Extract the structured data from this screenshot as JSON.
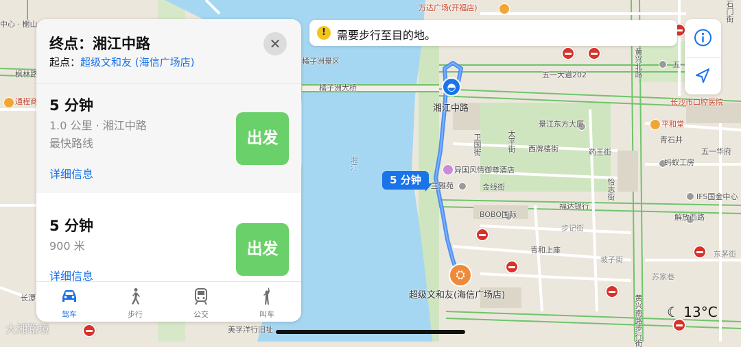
{
  "map": {
    "labels": {
      "wanda": "万达广场(开福店)",
      "xiangjiang_road": "湘江中路",
      "orange_isle": "橘子洲景区",
      "orange_bridge": "橘子洲大桥",
      "wuyi_ave": "五一大道202",
      "huangxing_n": "黄兴北路",
      "stomatology": "长沙市口腔医院",
      "hezhitang": "平和堂",
      "qingshijing": "青石井",
      "wuyi_hualou": "五一华府",
      "jingjiang": "景江东方大厦",
      "weiguo": "卫国街",
      "taiping": "太平街",
      "xipailou": "西牌楼街",
      "yaowang": "药王街",
      "yiguo": "异国风情御尊酒店",
      "lanyayuan": "兰雅苑",
      "jinxian": "金线街",
      "yizhi": "怡志街",
      "antworks": "蚂蚁工房",
      "ifs": "IFS国金中心",
      "fuda": "福达银行",
      "bobo": "BOBO国际",
      "jiefang_w": "解放西路",
      "buji": "步记街",
      "qinghe": "青和上座",
      "pozi": "坡子街",
      "dongmao": "东茅街",
      "sujia": "苏家巷",
      "destination_poi": "超级文和友(海信广场店)",
      "meiyang": "美孚洋行旧址",
      "tongchengtang": "通程商业",
      "fenglin": "枫林路",
      "zhongxin": "中心 · 榭山",
      "changshan": "长潭",
      "river": "湘江",
      "wuyi_short": "五一",
      "huangxing_s": "黄兴南路步行街",
      "shitai": "石门街"
    }
  },
  "panel": {
    "destination": "终点：湘江中路",
    "origin_prefix": "起点：",
    "origin_name": "超级文和友 (海信广场店)",
    "close_icon": "close-icon",
    "routes": [
      {
        "time": "5 分钟",
        "line1": "1.0 公里 · 湘江中路",
        "line2": "最快路线",
        "detail": "详细信息",
        "go": "出发"
      },
      {
        "time": "5 分钟",
        "line1": "900 米",
        "detail": "详细信息",
        "go": "出发"
      }
    ],
    "tabs": [
      {
        "label": "驾车",
        "icon": "car-icon",
        "active": true
      },
      {
        "label": "步行",
        "icon": "walk-icon",
        "active": false
      },
      {
        "label": "公交",
        "icon": "train-icon",
        "active": false
      },
      {
        "label": "叫车",
        "icon": "hail-icon",
        "active": false
      }
    ]
  },
  "banner": {
    "icon": "warning-icon",
    "text": "需要步行至目的地。"
  },
  "controls": {
    "info_icon": "info-icon",
    "location_icon": "location-arrow-icon"
  },
  "route_bubble": "5 分钟",
  "weather": {
    "icon": "moon-icon",
    "temp": "13°C"
  },
  "watermark": "大湘路境",
  "colors": {
    "accent": "#1a73e8",
    "go_green": "#6ad069",
    "route_blue": "#3d86f5",
    "river": "#a6d7f2"
  }
}
